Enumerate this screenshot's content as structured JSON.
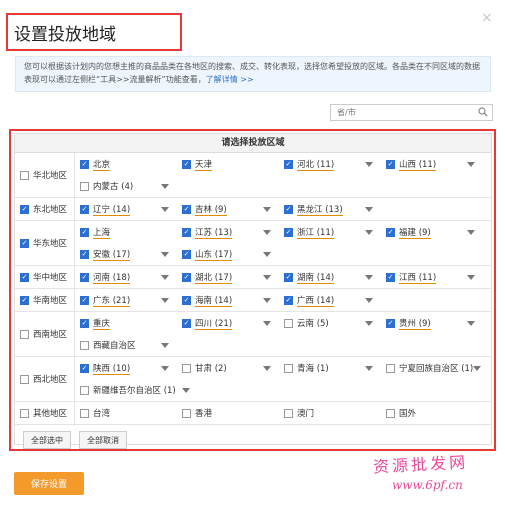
{
  "dialog": {
    "title": "设置投放地域",
    "close_glyph": "×",
    "info_text": "您可以根据该计划内的您想主推的商品品类在各地区的搜索、成交、转化表现，选择您希望投放的区域。各品类在不同区域的数据表现可以通过左侧栏“工具>>流量解析”功能查看，",
    "info_link": "了解详情 >>",
    "search_placeholder": "省/市",
    "panel_header": "请选择投放区域",
    "select_all": "全部选中",
    "deselect_all": "全部取消",
    "save": "保存设置"
  },
  "regions": [
    {
      "name": "华北地区",
      "checked": false,
      "lines": [
        [
          {
            "label": "北京",
            "checked": true,
            "arrow": false
          },
          {
            "label": "天津",
            "checked": true,
            "arrow": false
          },
          {
            "label": "河北 (11)",
            "checked": true,
            "arrow": true
          },
          {
            "label": "山西 (11)",
            "checked": true,
            "arrow": true
          }
        ],
        [
          {
            "label": "内蒙古 (4)",
            "checked": false,
            "arrow": true
          }
        ]
      ]
    },
    {
      "name": "东北地区",
      "checked": true,
      "lines": [
        [
          {
            "label": "辽宁 (14)",
            "checked": true,
            "arrow": true
          },
          {
            "label": "吉林 (9)",
            "checked": true,
            "arrow": true
          },
          {
            "label": "黑龙江 (13)",
            "checked": true,
            "arrow": true
          }
        ]
      ]
    },
    {
      "name": "华东地区",
      "checked": true,
      "lines": [
        [
          {
            "label": "上海",
            "checked": true,
            "arrow": false
          },
          {
            "label": "江苏 (13)",
            "checked": true,
            "arrow": true
          },
          {
            "label": "浙江 (11)",
            "checked": true,
            "arrow": true
          },
          {
            "label": "福建 (9)",
            "checked": true,
            "arrow": true
          }
        ],
        [
          {
            "label": "安徽 (17)",
            "checked": true,
            "arrow": true
          },
          {
            "label": "山东 (17)",
            "checked": true,
            "arrow": true
          }
        ]
      ]
    },
    {
      "name": "华中地区",
      "checked": true,
      "lines": [
        [
          {
            "label": "河南 (18)",
            "checked": true,
            "arrow": true
          },
          {
            "label": "湖北 (17)",
            "checked": true,
            "arrow": true
          },
          {
            "label": "湖南 (14)",
            "checked": true,
            "arrow": true
          },
          {
            "label": "江西 (11)",
            "checked": true,
            "arrow": true
          }
        ]
      ]
    },
    {
      "name": "华南地区",
      "checked": true,
      "lines": [
        [
          {
            "label": "广东 (21)",
            "checked": true,
            "arrow": true
          },
          {
            "label": "海南 (14)",
            "checked": true,
            "arrow": true
          },
          {
            "label": "广西 (14)",
            "checked": true,
            "arrow": true
          }
        ]
      ]
    },
    {
      "name": "西南地区",
      "checked": false,
      "lines": [
        [
          {
            "label": "重庆",
            "checked": true,
            "arrow": false
          },
          {
            "label": "四川 (21)",
            "checked": true,
            "arrow": true
          },
          {
            "label": "云南 (5)",
            "checked": false,
            "arrow": true
          },
          {
            "label": "贵州 (9)",
            "checked": true,
            "arrow": true
          }
        ],
        [
          {
            "label": "西藏自治区",
            "checked": false,
            "arrow": true
          }
        ]
      ]
    },
    {
      "name": "西北地区",
      "checked": false,
      "lines": [
        [
          {
            "label": "陕西 (10)",
            "checked": true,
            "arrow": true
          },
          {
            "label": "甘肃 (2)",
            "checked": false,
            "arrow": true
          },
          {
            "label": "青海 (1)",
            "checked": false,
            "arrow": true
          },
          {
            "label": "宁夏回族自治区 (1)",
            "checked": false,
            "arrow": true
          }
        ],
        [
          {
            "label": "新疆维吾尔自治区 (1)",
            "checked": false,
            "arrow": true,
            "wide": true
          }
        ]
      ]
    },
    {
      "name": "其他地区",
      "checked": false,
      "lines": [
        [
          {
            "label": "台湾",
            "checked": false,
            "arrow": false
          },
          {
            "label": "香港",
            "checked": false,
            "arrow": false
          },
          {
            "label": "澳门",
            "checked": false,
            "arrow": false
          },
          {
            "label": "国外",
            "checked": false,
            "arrow": false
          }
        ]
      ]
    }
  ],
  "watermark": {
    "line1": "资源批发网",
    "line2": "www.6pf.cn"
  }
}
